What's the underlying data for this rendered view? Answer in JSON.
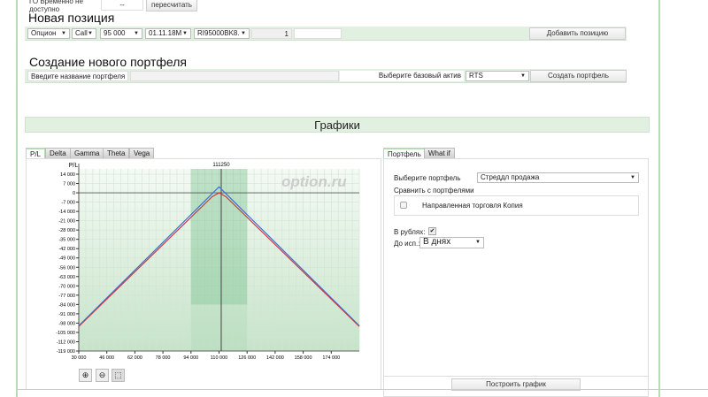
{
  "top": {
    "go_label": "ГО Временно не доступно",
    "go_value": "--",
    "recalc": "пересчитать"
  },
  "new_position": {
    "title": "Новая позиция",
    "type": "Опцион",
    "kind": "Call",
    "strike": "95 000",
    "expiry": "01.11.18M",
    "ticker": "RI95000BK8.",
    "qty": "1",
    "add": "Добавить позицию"
  },
  "new_portfolio": {
    "title": "Создание нового портфеля",
    "name_label": "Введите название портфеля",
    "name_value": "",
    "asset_label": "Выберите базовый актив",
    "asset": "RTS",
    "create": "Создать портфель"
  },
  "graphs": {
    "title": "Графики",
    "tabs": [
      "P/L",
      "Delta",
      "Gamma",
      "Theta",
      "Vega"
    ],
    "active_tab": "P/L",
    "watermark": "option.ru"
  },
  "side": {
    "tabs": [
      "Портфель",
      "What if"
    ],
    "select_label": "Выберите портфель",
    "portfolio": "Стреддл продажа",
    "compare_label": "Сравнить с портфелями",
    "compare_item": "Направленная торговля Копия",
    "compare_checked": false,
    "rub_label": "В рублях:",
    "rub_checked": true,
    "exp_label": "До исп.:",
    "exp_value": "В днях",
    "build": "Построить график"
  },
  "chart_data": {
    "type": "line",
    "ylabel": "P/L",
    "marker_label": "111250",
    "marker_x": 111250,
    "xlim": [
      30000,
      190000
    ],
    "ylim": [
      -119000,
      18000
    ],
    "xticks": [
      30000,
      46000,
      62000,
      78000,
      94000,
      110000,
      126000,
      142000,
      158000,
      174000
    ],
    "xtick_labels": [
      "30 000",
      "46 000",
      "62 000",
      "78 000",
      "94 000",
      "110 000",
      "126 000",
      "142 000",
      "158 000",
      "174 000"
    ],
    "yticks": [
      14000,
      7000,
      0,
      -7000,
      -14000,
      -21000,
      -28000,
      -35000,
      -42000,
      -49000,
      -56000,
      -63000,
      -70000,
      -77000,
      -84000,
      -91000,
      -98000,
      -105000,
      -112000,
      -119000
    ],
    "ytick_labels": [
      "14 000",
      "7 000",
      "0",
      "-7 000",
      "-14 000",
      "-21 000",
      "-28 000",
      "-35 000",
      "-42 000",
      "-49 000",
      "-56 000",
      "-63 000",
      "-70 000",
      "-77 000",
      "-84 000",
      "-91 000",
      "-98 000",
      "-105 000",
      "-112 000",
      "-119 000"
    ],
    "band": {
      "x": [
        94000,
        126000
      ],
      "y_bottom": -84000
    },
    "series": [
      {
        "color": "#3a6fe0",
        "points": [
          [
            30000,
            -100000
          ],
          [
            110000,
            4500
          ],
          [
            190000,
            -100000
          ]
        ]
      },
      {
        "color": "#d03a3a",
        "points": [
          [
            30000,
            -100500
          ],
          [
            106000,
            -3000
          ],
          [
            110000,
            0
          ],
          [
            114000,
            -3000
          ],
          [
            190000,
            -100500
          ]
        ]
      }
    ],
    "grid": true
  }
}
